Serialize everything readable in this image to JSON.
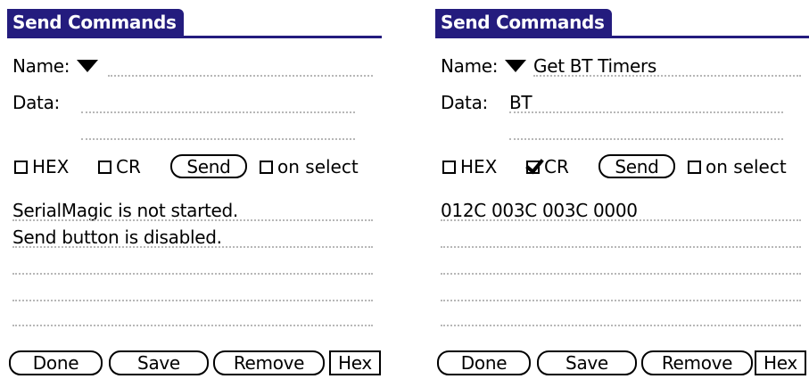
{
  "panels": [
    {
      "title": "Send Commands",
      "name_label": "Name:",
      "name_value": "",
      "data_label": "Data:",
      "data_value": "",
      "hex_label": "HEX",
      "hex_checked": false,
      "cr_label": "CR",
      "cr_checked": false,
      "send_label": "Send",
      "on_select_label": "on select",
      "on_select_checked": false,
      "output_lines": [
        "SerialMagic is not started.",
        "Send button is disabled."
      ],
      "buttons": {
        "done": "Done",
        "save": "Save",
        "remove": "Remove",
        "hex": "Hex"
      }
    },
    {
      "title": "Send Commands",
      "name_label": "Name:",
      "name_value": "Get BT Timers",
      "data_label": "Data:",
      "data_value": "BT",
      "hex_label": "HEX",
      "hex_checked": false,
      "cr_label": "CR",
      "cr_checked": true,
      "send_label": "Send",
      "on_select_label": "on select",
      "on_select_checked": false,
      "output_lines": [
        "012C 003C 003C 0000",
        ""
      ],
      "buttons": {
        "done": "Done",
        "save": "Save",
        "remove": "Remove",
        "hex": "Hex"
      }
    }
  ]
}
